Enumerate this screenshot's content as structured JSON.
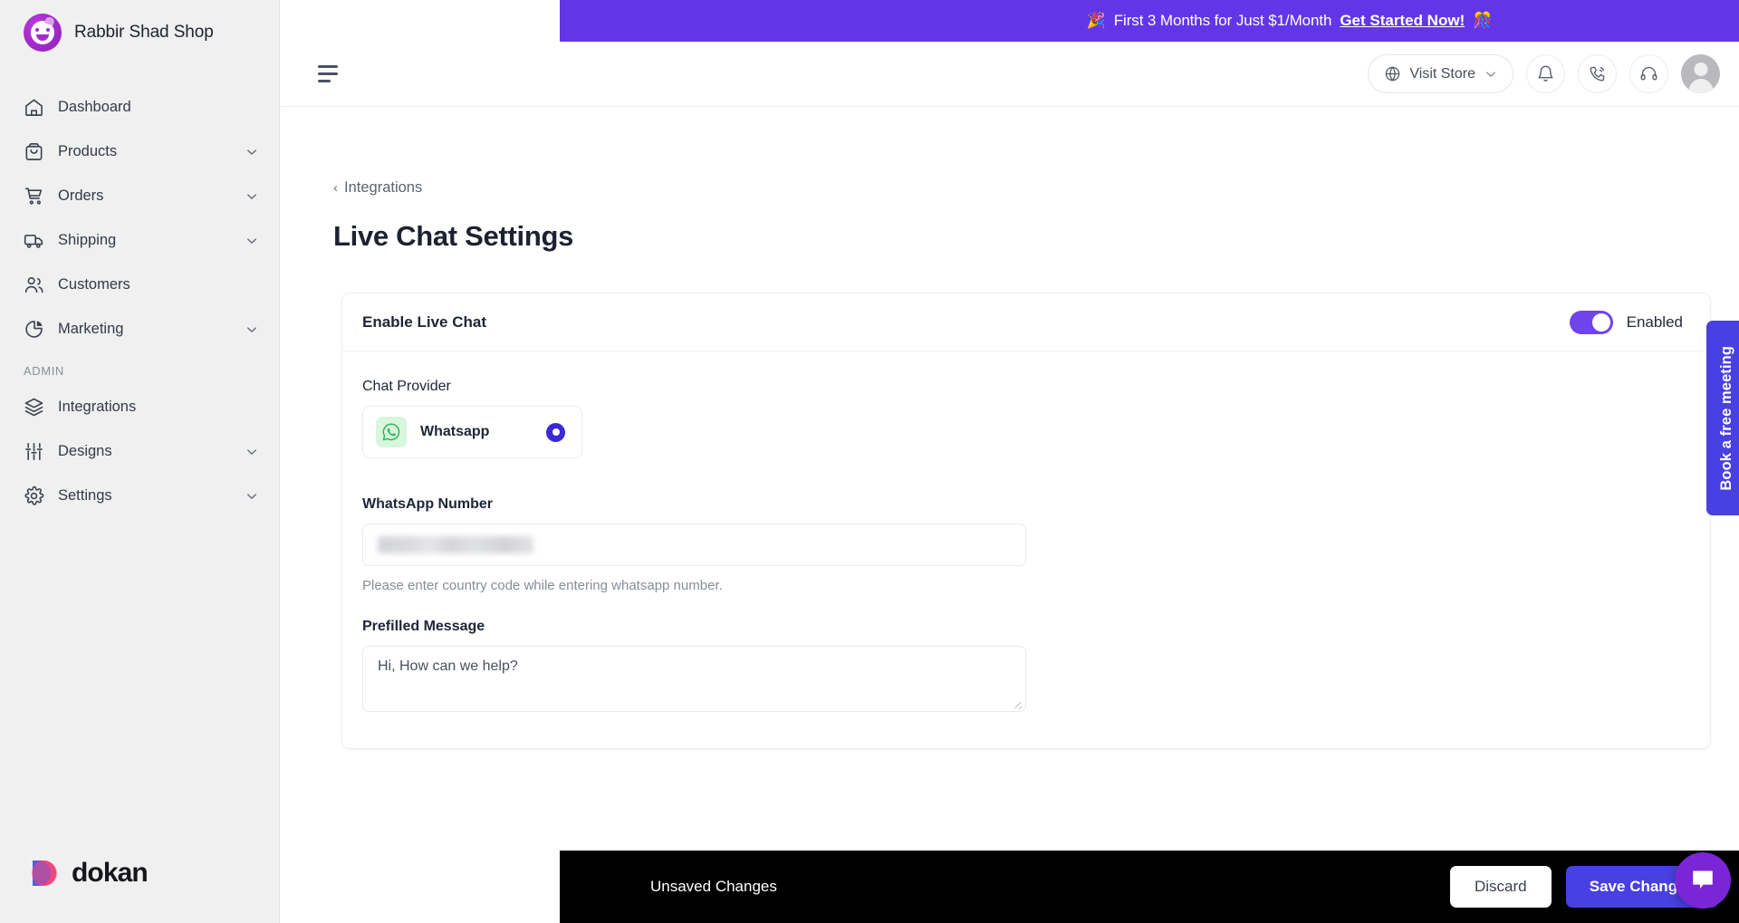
{
  "brand": {
    "name": "Rabbir Shad Shop",
    "avatar_icon": "winking-face-avatar"
  },
  "promo": {
    "emoji_left": "🎉",
    "text": "First 3 Months for Just $1/Month",
    "link": "Get Started Now!",
    "emoji_right": "🎊",
    "background": "#6236e8"
  },
  "sidebar": {
    "items": [
      {
        "label": "Dashboard",
        "icon": "home-icon",
        "expandable": false
      },
      {
        "label": "Products",
        "icon": "bag-icon",
        "expandable": true
      },
      {
        "label": "Orders",
        "icon": "cart-icon",
        "expandable": true
      },
      {
        "label": "Shipping",
        "icon": "truck-icon",
        "expandable": true
      },
      {
        "label": "Customers",
        "icon": "users-icon",
        "expandable": false
      },
      {
        "label": "Marketing",
        "icon": "pie-chart-icon",
        "expandable": true
      }
    ],
    "admin_group_label": "ADMIN",
    "admin_items": [
      {
        "label": "Integrations",
        "icon": "layers-icon",
        "expandable": false
      },
      {
        "label": "Designs",
        "icon": "sliders-icon",
        "expandable": true
      },
      {
        "label": "Settings",
        "icon": "gear-icon",
        "expandable": true
      }
    ],
    "footer_logo_text": "dokan"
  },
  "topbar": {
    "menu_icon": "hamburger-icon",
    "visit_store_label": "Visit Store",
    "visit_store_icon": "globe-icon",
    "visit_store_chevron": "chevron-down-icon",
    "notification_icon": "bell-icon",
    "call_icon": "phone-ring-icon",
    "support_icon": "headset-icon",
    "avatar_icon": "user-avatar"
  },
  "page": {
    "breadcrumb_chevron": "‹",
    "breadcrumb_label": "Integrations",
    "title": "Live Chat Settings"
  },
  "card": {
    "header_title": "Enable Live Chat",
    "toggle_state_label": "Enabled",
    "toggle_on": true,
    "toggle_color": "#7044ec",
    "chat_provider": {
      "label": "Chat Provider",
      "options": [
        {
          "name": "Whatsapp",
          "icon": "whatsapp-icon",
          "icon_background": "#d7f7dd",
          "selected": true
        }
      ]
    },
    "whatsapp_number": {
      "label": "WhatsApp Number",
      "value": "",
      "value_redacted": true,
      "placeholder": "",
      "helper": "Please enter country code while entering whatsapp number."
    },
    "prefilled_message": {
      "label": "Prefilled Message",
      "value": "Hi, How can we help?",
      "placeholder": "Hi, How can we help?"
    }
  },
  "side_tab": {
    "label": "Book a free meeting",
    "background": "#4840e0"
  },
  "savebar": {
    "status": "Unsaved Changes",
    "discard_label": "Discard",
    "save_label": "Save Changes",
    "save_color": "#4840e0",
    "background": "#000000"
  },
  "chat_widget": {
    "icon": "chat-bubble-icon",
    "background": "#7b26d6"
  }
}
